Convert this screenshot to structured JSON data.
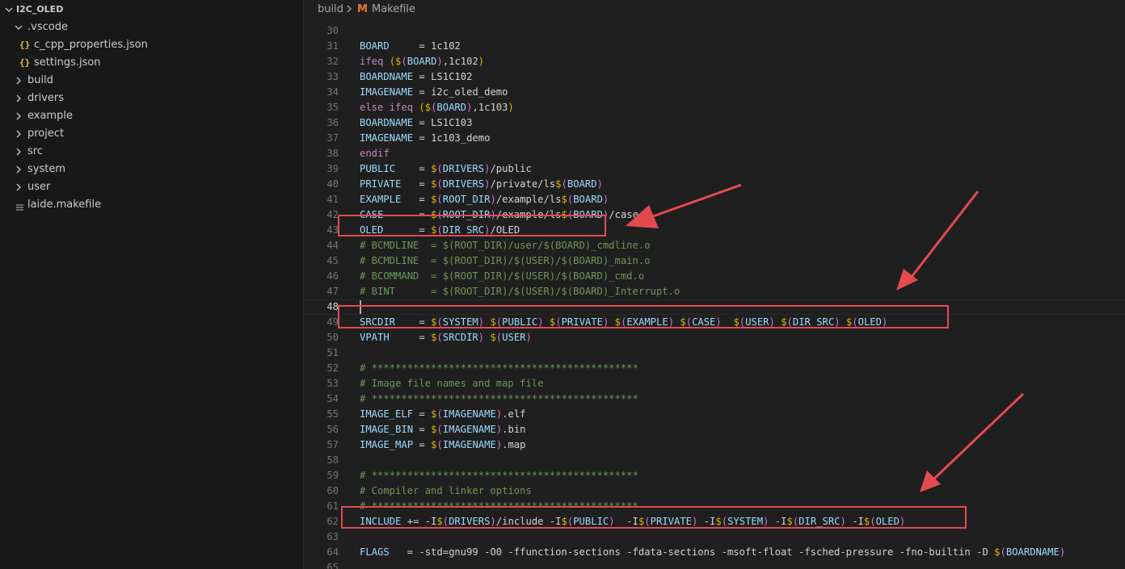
{
  "explorer": {
    "root": "I2C_OLED",
    "items": [
      {
        "label": ".vscode",
        "kind": "folder-open",
        "depth": 1
      },
      {
        "label": "c_cpp_properties.json",
        "kind": "json",
        "depth": 2
      },
      {
        "label": "settings.json",
        "kind": "json",
        "depth": 2
      },
      {
        "label": "build",
        "kind": "folder",
        "depth": 1
      },
      {
        "label": "drivers",
        "kind": "folder",
        "depth": 1
      },
      {
        "label": "example",
        "kind": "folder",
        "depth": 1
      },
      {
        "label": "project",
        "kind": "folder",
        "depth": 1
      },
      {
        "label": "src",
        "kind": "folder",
        "depth": 1
      },
      {
        "label": "system",
        "kind": "folder",
        "depth": 1
      },
      {
        "label": "user",
        "kind": "folder",
        "depth": 1
      },
      {
        "label": "laide.makefile",
        "kind": "file-lines",
        "depth": 1
      }
    ]
  },
  "breadcrumb": {
    "folder": "build",
    "file_icon": "M",
    "file": "Makefile"
  },
  "editor": {
    "active_line": "48",
    "lines": [
      {
        "n": "30",
        "t": ""
      },
      {
        "n": "31",
        "t": "BOARD     = 1c102"
      },
      {
        "n": "32",
        "t": "ifeq ($(BOARD),1c102)"
      },
      {
        "n": "33",
        "t": "BOARDNAME = LS1C102"
      },
      {
        "n": "34",
        "t": "IMAGENAME = i2c_oled_demo"
      },
      {
        "n": "35",
        "t": "else ifeq ($(BOARD),1c103)"
      },
      {
        "n": "36",
        "t": "BOARDNAME = LS1C103"
      },
      {
        "n": "37",
        "t": "IMAGENAME = 1c103_demo"
      },
      {
        "n": "38",
        "t": "endif"
      },
      {
        "n": "39",
        "t": "PUBLIC    = $(DRIVERS)/public"
      },
      {
        "n": "40",
        "t": "PRIVATE   = $(DRIVERS)/private/ls$(BOARD)"
      },
      {
        "n": "41",
        "t": "EXAMPLE   = $(ROOT_DIR)/example/ls$(BOARD)"
      },
      {
        "n": "42",
        "t": "CASE      = $(ROOT_DIR)/example/ls$(BOARD)/case"
      },
      {
        "n": "43",
        "t": "OLED      = $(DIR_SRC)/OLED"
      },
      {
        "n": "44",
        "t": "# BCMDLINE  = $(ROOT_DIR)/user/$(BOARD)_cmdline.o"
      },
      {
        "n": "45",
        "t": "# BCMDLINE  = $(ROOT_DIR)/$(USER)/$(BOARD)_main.o"
      },
      {
        "n": "46",
        "t": "# BCOMMAND  = $(ROOT_DIR)/$(USER)/$(BOARD)_cmd.o"
      },
      {
        "n": "47",
        "t": "# BINT      = $(ROOT_DIR)/$(USER)/$(BOARD)_Interrupt.o"
      },
      {
        "n": "48",
        "t": ""
      },
      {
        "n": "49",
        "t": "SRCDIR    = $(SYSTEM) $(PUBLIC) $(PRIVATE) $(EXAMPLE) $(CASE)  $(USER) $(DIR_SRC) $(OLED)"
      },
      {
        "n": "50",
        "t": "VPATH     = $(SRCDIR) $(USER)"
      },
      {
        "n": "51",
        "t": ""
      },
      {
        "n": "52",
        "t": "# *********************************************"
      },
      {
        "n": "53",
        "t": "# Image file names and map file"
      },
      {
        "n": "54",
        "t": "# *********************************************"
      },
      {
        "n": "55",
        "t": "IMAGE_ELF = $(IMAGENAME).elf"
      },
      {
        "n": "56",
        "t": "IMAGE_BIN = $(IMAGENAME).bin"
      },
      {
        "n": "57",
        "t": "IMAGE_MAP = $(IMAGENAME).map"
      },
      {
        "n": "58",
        "t": ""
      },
      {
        "n": "59",
        "t": "# *********************************************"
      },
      {
        "n": "60",
        "t": "# Compiler and linker options"
      },
      {
        "n": "61",
        "t": "# *********************************************"
      },
      {
        "n": "62",
        "t": "INCLUDE += -I$(DRIVERS)/include -I$(PUBLIC)  -I$(PRIVATE) -I$(SYSTEM) -I$(DIR_SRC) -I$(OLED)"
      },
      {
        "n": "63",
        "t": ""
      },
      {
        "n": "64",
        "t": "FLAGS   = -std=gnu99 -O0 -ffunction-sections -fdata-sections -msoft-float -fsched-pressure -fno-builtin -D $(BOARDNAME)"
      },
      {
        "n": "65",
        "t": ""
      }
    ]
  },
  "colors": {
    "annotation": "#e34a50",
    "accent": "#e37933"
  }
}
